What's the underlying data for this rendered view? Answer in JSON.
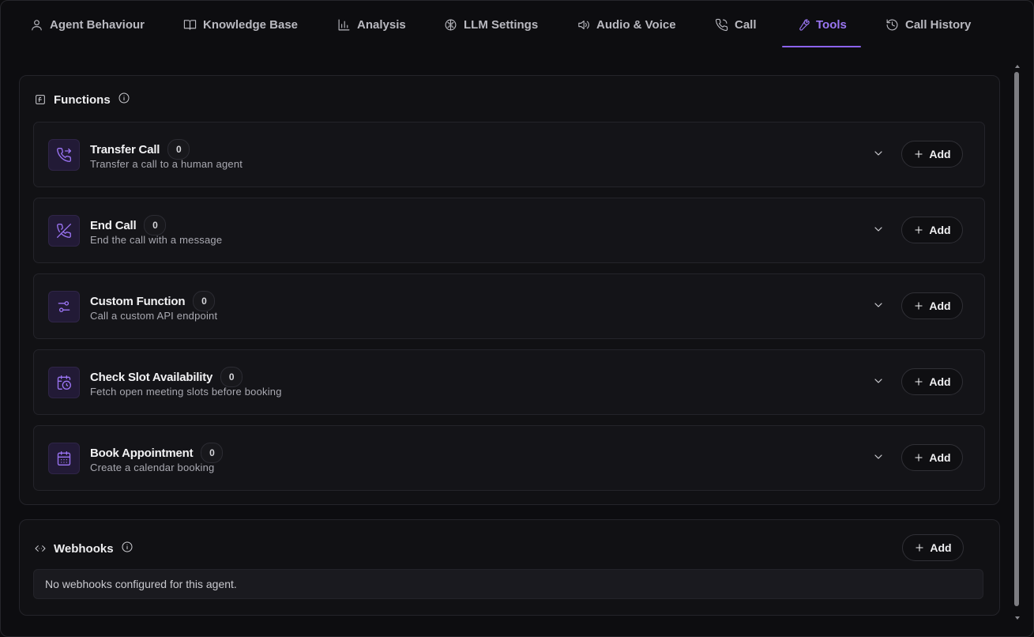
{
  "tabs": [
    {
      "label": "Agent Behaviour",
      "icon": "user-icon"
    },
    {
      "label": "Knowledge Base",
      "icon": "book-icon"
    },
    {
      "label": "Analysis",
      "icon": "bar-chart-icon"
    },
    {
      "label": "LLM Settings",
      "icon": "brain-icon"
    },
    {
      "label": "Audio & Voice",
      "icon": "speaker-icon"
    },
    {
      "label": "Call",
      "icon": "phone-icon"
    },
    {
      "label": "Tools",
      "icon": "wrench-icon"
    },
    {
      "label": "Call History",
      "icon": "history-icon"
    }
  ],
  "active_tab": "Tools",
  "accent_color": "#9a76f3",
  "functions": {
    "title": "Functions",
    "items": [
      {
        "title": "Transfer Call",
        "count": "0",
        "description": "Transfer a call to a human agent",
        "icon": "phone-forward-icon",
        "add_label": "Add"
      },
      {
        "title": "End Call",
        "count": "0",
        "description": "End the call with a message",
        "icon": "phone-off-icon",
        "add_label": "Add"
      },
      {
        "title": "Custom Function",
        "count": "0",
        "description": "Call a custom API endpoint",
        "icon": "sliders-icon",
        "add_label": "Add"
      },
      {
        "title": "Check Slot Availability",
        "count": "0",
        "description": "Fetch open meeting slots before booking",
        "icon": "calendar-clock-icon",
        "add_label": "Add"
      },
      {
        "title": "Book Appointment",
        "count": "0",
        "description": "Create a calendar booking",
        "icon": "calendar-icon",
        "add_label": "Add"
      }
    ]
  },
  "webhooks": {
    "title": "Webhooks",
    "add_label": "Add",
    "empty_text": "No webhooks configured for this agent."
  }
}
